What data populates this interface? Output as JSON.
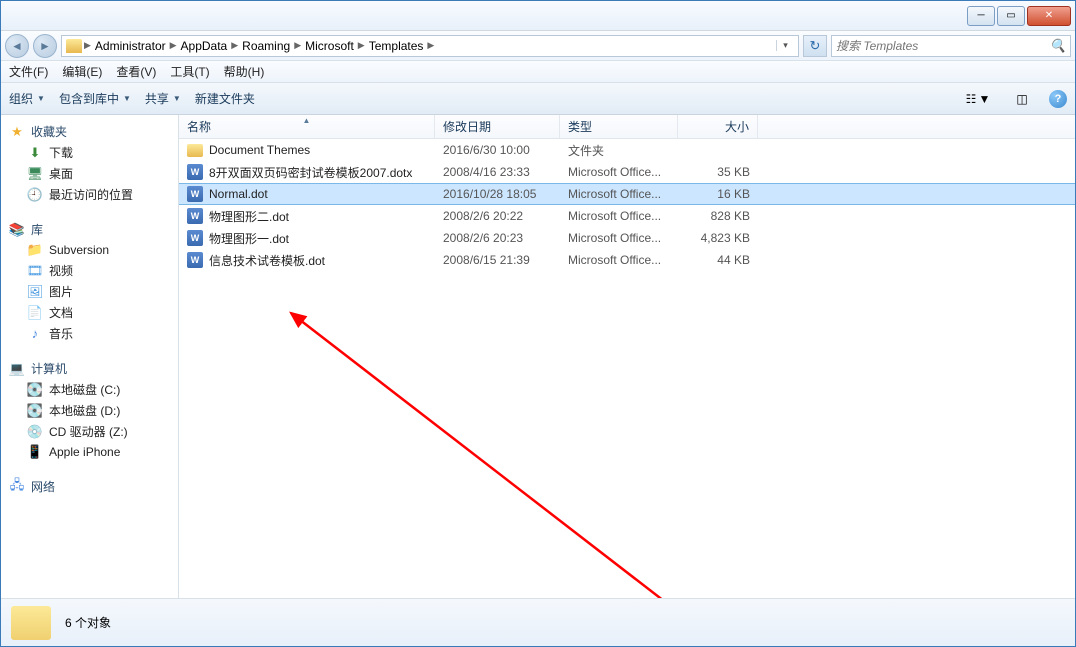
{
  "breadcrumb": [
    "Administrator",
    "AppData",
    "Roaming",
    "Microsoft",
    "Templates"
  ],
  "search_placeholder": "搜索 Templates",
  "menubar": {
    "file": "文件(F)",
    "edit": "编辑(E)",
    "view": "查看(V)",
    "tools": "工具(T)",
    "help": "帮助(H)"
  },
  "toolbar": {
    "organize": "组织",
    "include": "包含到库中",
    "share": "共享",
    "newfolder": "新建文件夹"
  },
  "columns": {
    "name": "名称",
    "date": "修改日期",
    "type": "类型",
    "size": "大小"
  },
  "sidebar": {
    "favorites": {
      "head": "收藏夹",
      "items": [
        "下载",
        "桌面",
        "最近访问的位置"
      ]
    },
    "libraries": {
      "head": "库",
      "items": [
        "Subversion",
        "视频",
        "图片",
        "文档",
        "音乐"
      ]
    },
    "computer": {
      "head": "计算机",
      "items": [
        "本地磁盘 (C:)",
        "本地磁盘 (D:)",
        "CD 驱动器 (Z:)",
        "Apple iPhone"
      ]
    },
    "network": {
      "head": "网络"
    }
  },
  "files": [
    {
      "icon": "folder",
      "name": "Document Themes",
      "date": "2016/6/30 10:00",
      "type": "文件夹",
      "size": ""
    },
    {
      "icon": "word",
      "name": "8开双面双页码密封试卷模板2007.dotx",
      "date": "2008/4/16 23:33",
      "type": "Microsoft Office...",
      "size": "35 KB"
    },
    {
      "icon": "word",
      "name": "Normal.dot",
      "date": "2016/10/28 18:05",
      "type": "Microsoft Office...",
      "size": "16 KB",
      "selected": true
    },
    {
      "icon": "word",
      "name": "物理图形二.dot",
      "date": "2008/2/6 20:22",
      "type": "Microsoft Office...",
      "size": "828 KB"
    },
    {
      "icon": "word",
      "name": "物理图形一.dot",
      "date": "2008/2/6 20:23",
      "type": "Microsoft Office...",
      "size": "4,823 KB"
    },
    {
      "icon": "word",
      "name": "信息技术试卷模板.dot",
      "date": "2008/6/15 21:39",
      "type": "Microsoft Office...",
      "size": "44 KB"
    }
  ],
  "status": "6 个对象"
}
